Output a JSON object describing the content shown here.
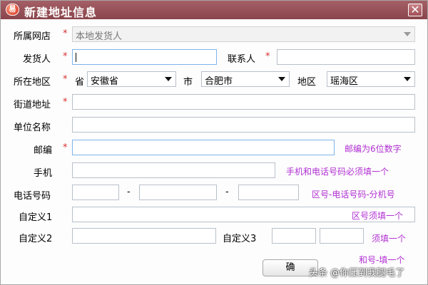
{
  "titlebar": {
    "app_icon_text": "易",
    "title": "新建地址信息",
    "close_symbol": "✕"
  },
  "form": {
    "store_label": "所属网店",
    "store_value": "本地发货人",
    "sender_label": "发货人",
    "contact_label": "联系人",
    "region_label": "所在地区",
    "province_label": "省",
    "province_value": "安徽省",
    "city_label": "市",
    "city_value": "合肥市",
    "district_label": "地区",
    "district_value": "瑶海区",
    "street_label": "街道地址",
    "company_label": "单位名称",
    "zip_label": "邮编",
    "zip_hint": "邮编为6位数字",
    "mobile_label": "手机",
    "mobile_hint": "手机和电话号码必须填一个",
    "phone_label": "电话号码",
    "phone_dash": "-",
    "phone_hint": "区号-电话号码-分机号",
    "custom1_label": "自定义1",
    "custom1_hint": "区号须填一个",
    "custom2_label": "自定义2",
    "custom3_label": "自定义3",
    "custom3_hint": "须填一个",
    "extra_hint": "和号-填一个",
    "required_mark": "*"
  },
  "buttons": {
    "ok_label": "确"
  },
  "watermark": "头条 @你压到我腿毛了",
  "colors": {
    "titlebar": "#9a555c",
    "hint": "#b12fd3",
    "required": "#d83030"
  }
}
